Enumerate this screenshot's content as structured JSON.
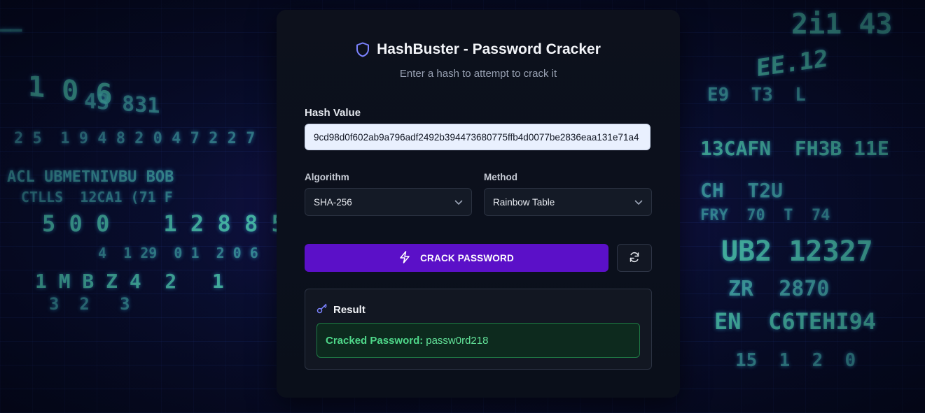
{
  "app": {
    "title": "HashBuster - Password Cracker",
    "subtitle": "Enter a hash to attempt to crack it",
    "icon": "shield-icon",
    "accent_color": "#5b10c8"
  },
  "form": {
    "hash_label": "Hash Value",
    "hash_value": "9cd98d0f602ab9a796adf2492b394473680775ffb4d0077be2836eaa131e71a4",
    "algorithm_label": "Algorithm",
    "algorithm_selected": "SHA-256",
    "method_label": "Method",
    "method_selected": "Rainbow Table"
  },
  "actions": {
    "crack_label": "CRACK PASSWORD",
    "crack_icon": "zap-icon",
    "refresh_icon": "refresh-icon"
  },
  "result": {
    "title": "Result",
    "icon": "key-icon",
    "cracked_label": "Cracked Password:",
    "cracked_value": "passw0rd218",
    "success_color": "#4fd88a"
  }
}
